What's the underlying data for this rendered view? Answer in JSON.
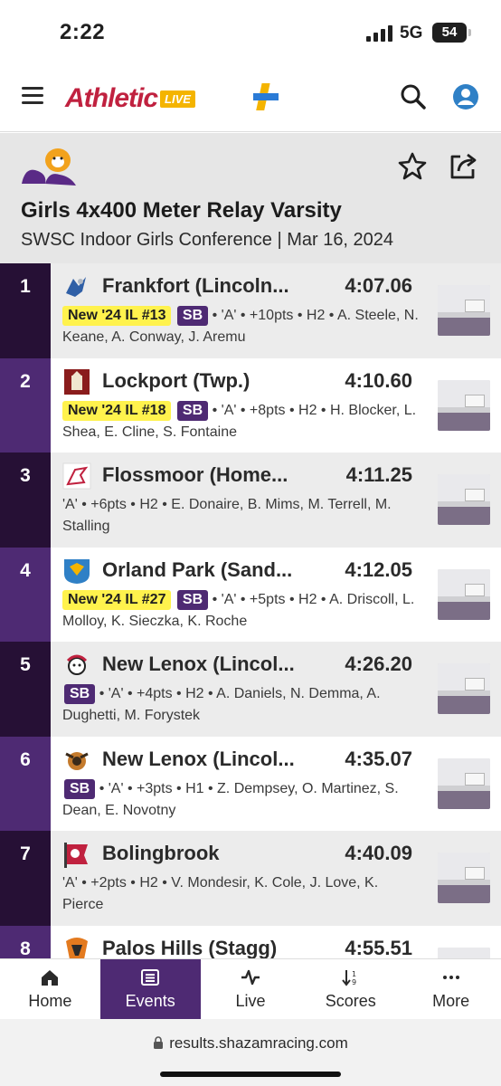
{
  "status_bar": {
    "time": "2:22",
    "network": "5G",
    "battery": "54"
  },
  "header": {
    "logo_text": "Athletic",
    "logo_badge": "LIVE"
  },
  "event": {
    "title": "Girls 4x400 Meter Relay Varsity",
    "subtitle": "SWSC Indoor Girls Conference | Mar 16, 2024"
  },
  "results": [
    {
      "place": "1",
      "team": "Frankfort (Lincoln...",
      "mark": "4:07.06",
      "new_badge": "New '24 IL #13",
      "sb": "SB",
      "details": "• 'A' • +10pts • H2 • A. Steele, N. Keane, A. Conway, J. Aremu"
    },
    {
      "place": "2",
      "team": "Lockport (Twp.)",
      "mark": "4:10.60",
      "new_badge": "New '24 IL #18",
      "sb": "SB",
      "details": "• 'A' • +8pts • H2 • H. Blocker, L. Shea, E. Cline, S. Fontaine"
    },
    {
      "place": "3",
      "team": "Flossmoor (Home...",
      "mark": "4:11.25",
      "new_badge": "",
      "sb": "",
      "details": "'A' • +6pts • H2 • E. Donaire, B. Mims, M. Terrell, M. Stalling"
    },
    {
      "place": "4",
      "team": "Orland Park (Sand...",
      "mark": "4:12.05",
      "new_badge": "New '24 IL #27",
      "sb": "SB",
      "details": "• 'A' • +5pts • H2 • A. Driscoll, L. Molloy, K. Sieczka, K. Roche"
    },
    {
      "place": "5",
      "team": "New Lenox (Lincol...",
      "mark": "4:26.20",
      "new_badge": "",
      "sb": "SB",
      "details": "• 'A' • +4pts • H2 • A. Daniels, N. Demma, A. Dughetti, M. Forystek"
    },
    {
      "place": "6",
      "team": "New Lenox (Lincol...",
      "mark": "4:35.07",
      "new_badge": "",
      "sb": "SB",
      "details": "• 'A' • +3pts • H1 • Z. Dempsey, O. Martinez, S. Dean, E. Novotny"
    },
    {
      "place": "7",
      "team": "Bolingbrook",
      "mark": "4:40.09",
      "new_badge": "",
      "sb": "",
      "details": "'A' • +2pts • H2 • V. Mondesir, K. Cole, J. Love, K. Pierce"
    },
    {
      "place": "8",
      "team": "Palos Hills (Stagg)",
      "mark": "4:55.51",
      "new_badge": "",
      "sb": "",
      "details": ""
    }
  ],
  "nav": [
    {
      "label": "Home",
      "icon": "home-icon"
    },
    {
      "label": "Events",
      "icon": "list-icon"
    },
    {
      "label": "Live",
      "icon": "pulse-icon"
    },
    {
      "label": "Scores",
      "icon": "sort-icon"
    },
    {
      "label": "More",
      "icon": "more-icon"
    }
  ],
  "url": "results.shazamracing.com",
  "colors": {
    "brand_purple": "#4e2a73",
    "dark_purple": "#261035",
    "logo_red": "#c0213f",
    "badge_yellow": "#fff24d"
  }
}
